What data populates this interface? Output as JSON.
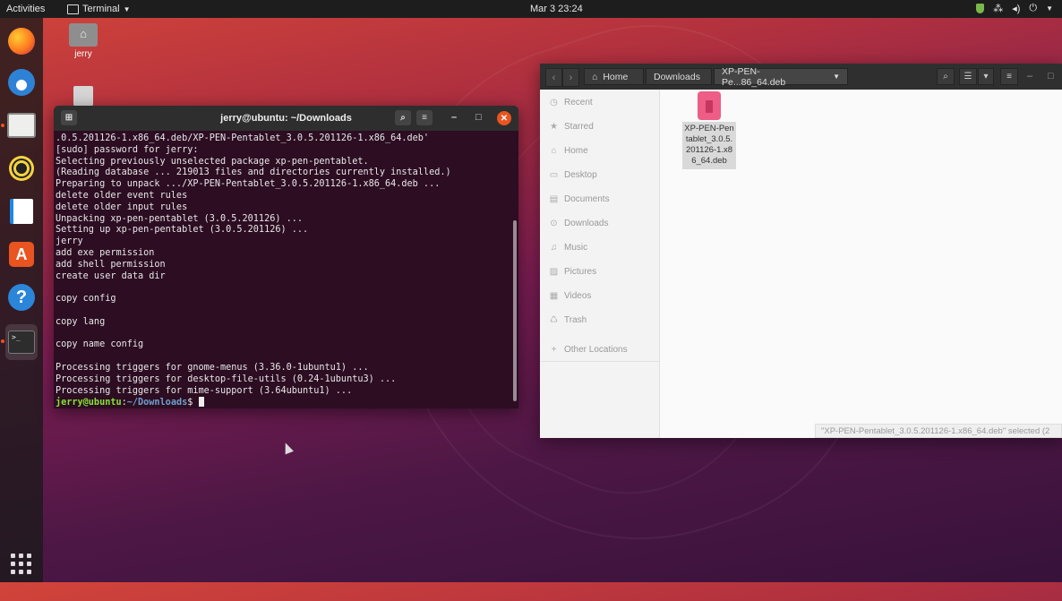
{
  "topbar": {
    "activities": "Activities",
    "app_menu": "Terminal",
    "clock": "Mar 3  23:24",
    "status_icons": [
      "network-icon",
      "volume-icon",
      "power-icon"
    ]
  },
  "dock": {
    "items": [
      "firefox-icon",
      "thunderbird-icon",
      "files-icon",
      "rhythmbox-icon",
      "libreoffice-writer-icon",
      "software-icon",
      "help-icon",
      "terminal-icon"
    ],
    "active": "terminal-icon",
    "show_apps": "show-applications-icon"
  },
  "desktop": {
    "home_label": "jerry"
  },
  "terminal": {
    "title": "jerry@ubuntu: ~/Downloads",
    "lines": [
      ".0.5.201126-1.x86_64.deb/XP-PEN-Pentablet_3.0.5.201126-1.x86_64.deb'",
      "[sudo] password for jerry:",
      "Selecting previously unselected package xp-pen-pentablet.",
      "(Reading database ... 219013 files and directories currently installed.)",
      "Preparing to unpack .../XP-PEN-Pentablet_3.0.5.201126-1.x86_64.deb ...",
      "delete older event rules",
      "delete older input rules",
      "Unpacking xp-pen-pentablet (3.0.5.201126) ...",
      "Setting up xp-pen-pentablet (3.0.5.201126) ...",
      "jerry",
      "add exe permission",
      "add shell permission",
      "create user data dir",
      "",
      "copy config",
      "",
      "copy lang",
      "",
      "copy name config",
      "",
      "Processing triggers for gnome-menus (3.36.0-1ubuntu1) ...",
      "Processing triggers for desktop-file-utils (0.24-1ubuntu3) ...",
      "Processing triggers for mime-support (3.64ubuntu1) ..."
    ],
    "prompt_user": "jerry@ubuntu",
    "prompt_sep": ":",
    "prompt_path": "~/Downloads",
    "prompt_symbol": "$"
  },
  "file_manager": {
    "breadcrumbs": [
      "Home",
      "Downloads",
      "XP-PEN-Pe...86_64.deb"
    ],
    "sidebar": [
      {
        "label": "Recent",
        "icon": "clock-icon",
        "glyph": "◷"
      },
      {
        "label": "Starred",
        "icon": "star-icon",
        "glyph": "★"
      },
      {
        "label": "Home",
        "icon": "home-icon",
        "glyph": "⌂"
      },
      {
        "label": "Desktop",
        "icon": "desktop-icon",
        "glyph": "▭"
      },
      {
        "label": "Documents",
        "icon": "document-icon",
        "glyph": "▤"
      },
      {
        "label": "Downloads",
        "icon": "download-icon",
        "glyph": "⊙"
      },
      {
        "label": "Music",
        "icon": "music-icon",
        "glyph": "♫"
      },
      {
        "label": "Pictures",
        "icon": "pictures-icon",
        "glyph": "▨"
      },
      {
        "label": "Videos",
        "icon": "videos-icon",
        "glyph": "▦"
      },
      {
        "label": "Trash",
        "icon": "trash-icon",
        "glyph": "♺"
      },
      {
        "label": "Other Locations",
        "icon": "plus-icon",
        "glyph": "+"
      }
    ],
    "file": {
      "name": "XP-PEN-Pentablet_3.0.5.201126-1.x86_64.deb"
    },
    "status": "\"XP-PEN-Pentablet_3.0.5.201126-1.x86_64.deb\" selected (2"
  }
}
